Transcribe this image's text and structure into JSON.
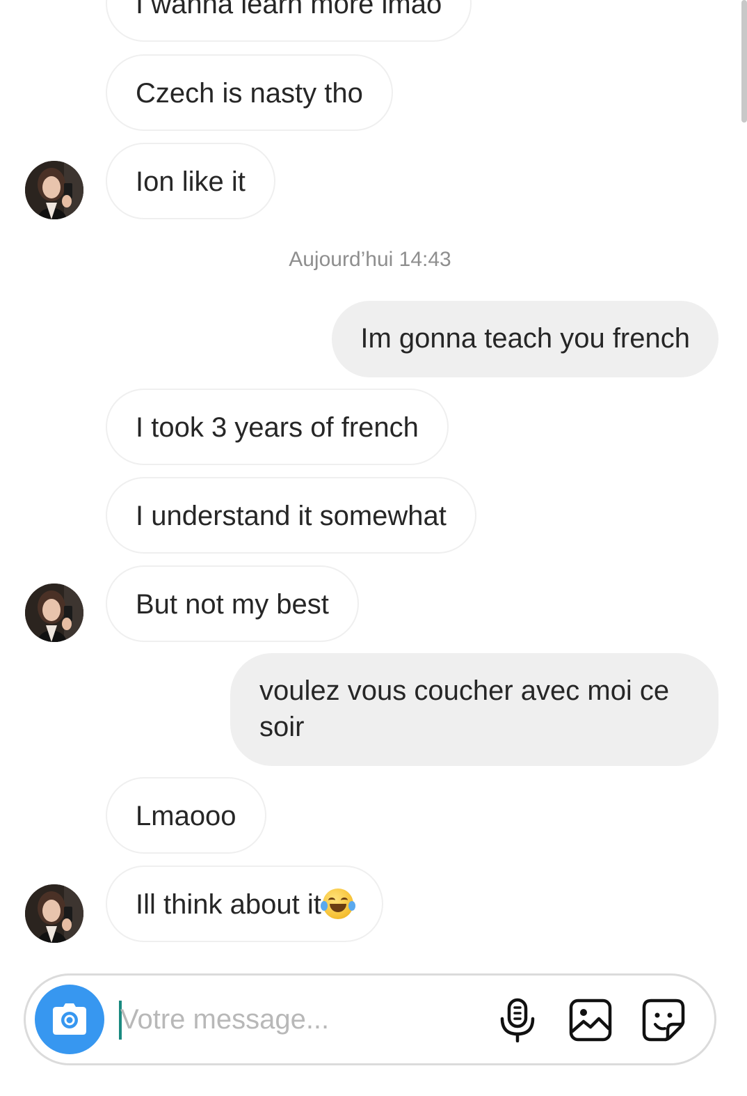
{
  "messages": [
    {
      "id": "m1",
      "side": "in",
      "text": "I wanna learn more lmao"
    },
    {
      "id": "m2",
      "side": "in",
      "text": "Czech is nasty tho"
    },
    {
      "id": "m3",
      "side": "in",
      "text": "Ion like it"
    },
    {
      "id": "m4",
      "side": "out",
      "text": "Im gonna teach you french"
    },
    {
      "id": "m5",
      "side": "in",
      "text": "I took 3 years of french"
    },
    {
      "id": "m6",
      "side": "in",
      "text": "I understand it somewhat"
    },
    {
      "id": "m7",
      "side": "in",
      "text": "But not my best"
    },
    {
      "id": "m8",
      "side": "out",
      "text": "voulez vous coucher avec moi ce soir"
    },
    {
      "id": "m9",
      "side": "in",
      "text": "Lmaooo"
    },
    {
      "id": "m10",
      "side": "in",
      "text": "Ill think about it",
      "emoji": "face-with-tears-of-joy"
    }
  ],
  "timestamp": "Aujourd’hui 14:43",
  "composer": {
    "placeholder": "Votre message...",
    "value": ""
  },
  "icons": {
    "camera": "camera-icon",
    "microphone": "microphone-icon",
    "gallery": "gallery-icon",
    "sticker": "sticker-icon"
  },
  "colors": {
    "accent": "#3797f0",
    "incoming_border": "#efefef",
    "outgoing_bg": "#efefef",
    "timestamp": "#8e8e8e",
    "placeholder": "#b8b8b8"
  }
}
